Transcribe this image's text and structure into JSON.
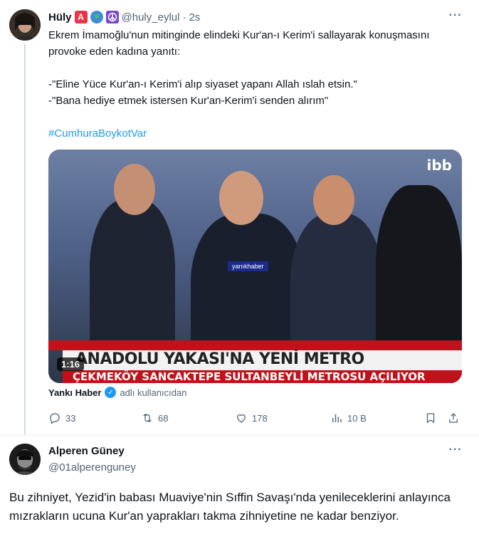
{
  "tweet": {
    "author_name": "Hüly",
    "author_emojis": [
      "A",
      "🌍",
      "☮"
    ],
    "handle": "@huly_eylul",
    "separator": "·",
    "time": "2s",
    "lines": [
      "Ekrem İmamoğlu'nun mitinginde elindeki Kur'an-ı Kerim'i sallayarak konuşmasını provoke eden kadına yanıtı:",
      "-\"Eline Yüce Kur'an-ı Kerim'i alıp siyaset yapanı Allah ıslah etsin.\"",
      "-\"Bana hediye etmek istersen Kur'an-Kerim'i senden alırım\""
    ],
    "hashtag": "#CumhuraBoykotVar",
    "media": {
      "duration": "1:16",
      "logo": "ibb",
      "watermark": "yanıkhaber",
      "headline": "ANADOLU YAKASI'NA YENİ METRO",
      "subline": "ÇEKMEKÖY SANCAKTEPE SULTANBEYLİ METROSU AÇILIYOR"
    },
    "source": {
      "name": "Yankı Haber",
      "by": "adlı kullanıcıdan"
    },
    "actions": {
      "replies": "33",
      "retweets": "68",
      "likes": "178",
      "views": "10 B"
    }
  },
  "reply": {
    "author_name": "Alperen Güney",
    "handle": "@01alperenguney",
    "text": "Bu zihniyet, Yezid'in babası Muaviye'nin Sıffin Savaşı'nda yenileceklerini anlayınca mızrakların ucuna Kur'an yaprakları takma zihniyetine ne kadar benziyor."
  },
  "colors": {
    "accent": "#1d9bf0",
    "muted": "#536471",
    "text": "#0f1419",
    "border": "#cfd9de"
  }
}
